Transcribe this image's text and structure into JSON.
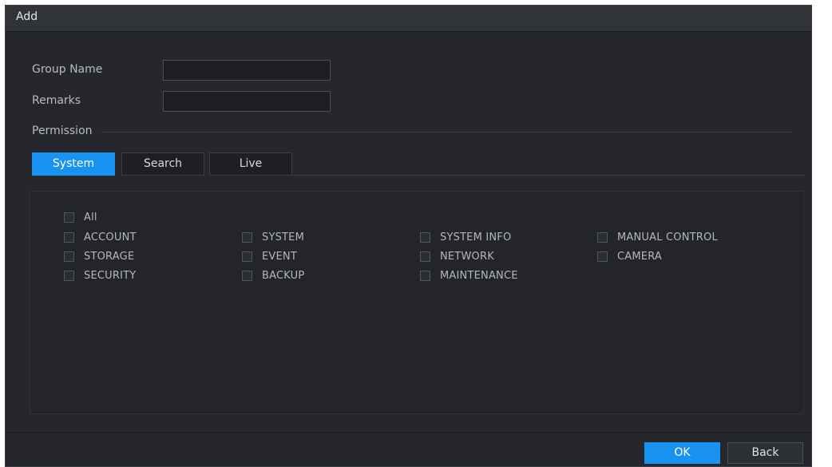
{
  "dialog": {
    "title": "Add"
  },
  "form": {
    "group_name_label": "Group Name",
    "group_name_value": "",
    "remarks_label": "Remarks",
    "remarks_value": "",
    "permission_label": "Permission"
  },
  "tabs": [
    {
      "label": "System",
      "active": true
    },
    {
      "label": "Search",
      "active": false
    },
    {
      "label": "Live",
      "active": false
    }
  ],
  "permissions": {
    "all_label": "All",
    "items": [
      {
        "label": "ACCOUNT",
        "checked": false
      },
      {
        "label": "SYSTEM",
        "checked": false
      },
      {
        "label": "SYSTEM INFO",
        "checked": false
      },
      {
        "label": "MANUAL CONTROL",
        "checked": false
      },
      {
        "label": "STORAGE",
        "checked": false
      },
      {
        "label": "EVENT",
        "checked": false
      },
      {
        "label": "NETWORK",
        "checked": false
      },
      {
        "label": "CAMERA",
        "checked": false
      },
      {
        "label": "SECURITY",
        "checked": false
      },
      {
        "label": "BACKUP",
        "checked": false
      },
      {
        "label": "MAINTENANCE",
        "checked": false
      }
    ]
  },
  "buttons": {
    "ok_label": "OK",
    "back_label": "Back"
  },
  "colors": {
    "accent": "#1993f2",
    "background": "#25272c",
    "titlebar": "#303338"
  }
}
